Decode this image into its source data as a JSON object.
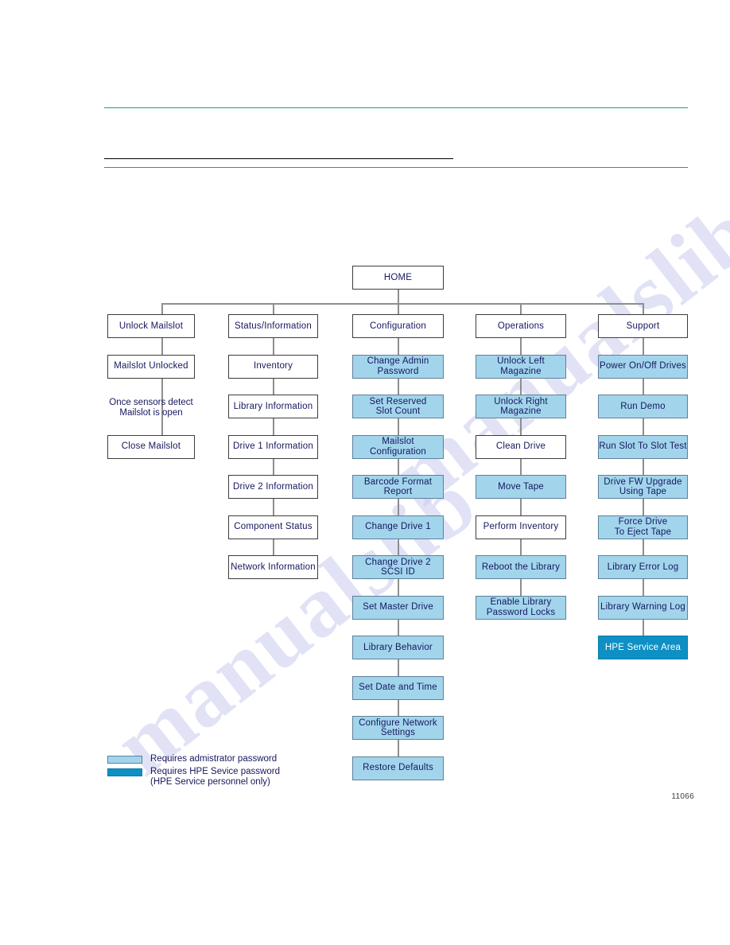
{
  "page": {
    "figure_id": "11066",
    "watermark_text": "manualslib",
    "rule_color": "#17a08c",
    "admin_color": "#a2d5ec",
    "service_color": "#0e90c4",
    "connector_color": "#8e8e8e"
  },
  "diagram": {
    "root": {
      "label": "HOME",
      "type": "plain"
    },
    "columns": [
      {
        "header": {
          "label": "Unlock Mailslot",
          "type": "plain"
        },
        "items": [
          {
            "label": "Mailslot Unlocked",
            "type": "plain"
          },
          {
            "label": "Once sensors detect\nMailslot is open",
            "type": "note"
          },
          {
            "label": "Close Mailslot",
            "type": "plain"
          }
        ]
      },
      {
        "header": {
          "label": "Status/Information",
          "type": "plain"
        },
        "items": [
          {
            "label": "Inventory",
            "type": "plain"
          },
          {
            "label": "Library Information",
            "type": "plain"
          },
          {
            "label": "Drive 1 Information",
            "type": "plain"
          },
          {
            "label": "Drive 2 Information",
            "type": "plain"
          },
          {
            "label": "Component Status",
            "type": "plain"
          },
          {
            "label": "Network Information",
            "type": "plain"
          }
        ]
      },
      {
        "header": {
          "label": "Configuration",
          "type": "plain"
        },
        "items": [
          {
            "label": "Change Admin\nPassword",
            "type": "admin"
          },
          {
            "label": "Set Reserved\nSlot Count",
            "type": "admin"
          },
          {
            "label": "Mailslot\nConfiguration",
            "type": "admin"
          },
          {
            "label": "Barcode Format\nReport",
            "type": "admin"
          },
          {
            "label": "Change Drive 1",
            "type": "admin"
          },
          {
            "label": "Change Drive 2\nSCSI ID",
            "type": "admin"
          },
          {
            "label": "Set Master Drive",
            "type": "admin"
          },
          {
            "label": "Library Behavior",
            "type": "admin"
          },
          {
            "label": "Set  Date and Time",
            "type": "admin"
          },
          {
            "label": "Configure Network\nSettings",
            "type": "admin"
          },
          {
            "label": "Restore Defaults",
            "type": "admin"
          }
        ]
      },
      {
        "header": {
          "label": "Operations",
          "type": "plain"
        },
        "items": [
          {
            "label": "Unlock Left Magazine",
            "type": "admin"
          },
          {
            "label": "Unlock Right Magazine",
            "type": "admin"
          },
          {
            "label": "Clean Drive",
            "type": "plain"
          },
          {
            "label": "Move Tape",
            "type": "admin"
          },
          {
            "label": "Perform Inventory",
            "type": "plain"
          },
          {
            "label": "Reboot the Library",
            "type": "admin"
          },
          {
            "label": "Enable Library\nPassword Locks",
            "type": "admin"
          }
        ]
      },
      {
        "header": {
          "label": "Support",
          "type": "plain"
        },
        "items": [
          {
            "label": "Power On/Off Drives",
            "type": "admin"
          },
          {
            "label": "Run Demo",
            "type": "admin"
          },
          {
            "label": "Run Slot To Slot Test",
            "type": "admin"
          },
          {
            "label": "Drive FW Upgrade\nUsing Tape",
            "type": "admin"
          },
          {
            "label": "Force Drive\nTo Eject Tape",
            "type": "admin"
          },
          {
            "label": "Library Error Log",
            "type": "admin"
          },
          {
            "label": "Library Warning Log",
            "type": "admin"
          },
          {
            "label": "HPE Service Area",
            "type": "service"
          }
        ]
      }
    ]
  },
  "legend": {
    "rows": [
      {
        "swatch": "admin",
        "label": "Requires admistrator password"
      },
      {
        "swatch": "service",
        "label": "Requires HPE Sevice password\n(HPE Service personnel only)"
      }
    ]
  }
}
